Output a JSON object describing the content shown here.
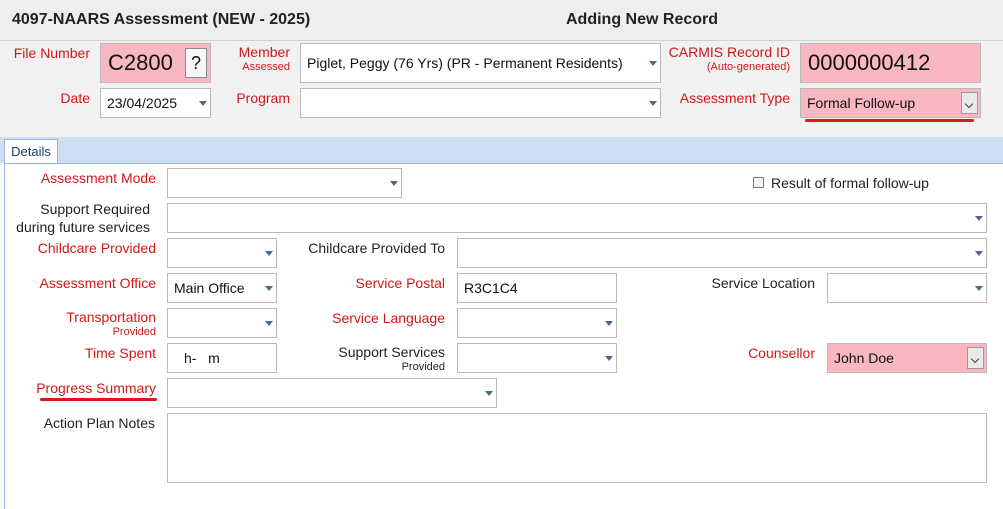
{
  "header": {
    "title": "4097-NAARS Assessment (NEW - 2025)",
    "mode": "Adding New Record"
  },
  "top_form": {
    "file_number": {
      "label": "File Number",
      "value": "C2800",
      "button_label": "?"
    },
    "member": {
      "label": "Member",
      "sublabel": "Assessed",
      "value": "Piglet, Peggy (76 Yrs) (PR - Permanent Residents)"
    },
    "carmis": {
      "label": "CARMIS Record ID",
      "sublabel": "(Auto-generated)",
      "value": "0000000412"
    },
    "date": {
      "label": "Date",
      "value": "23/04/2025"
    },
    "program": {
      "label": "Program",
      "value": ""
    },
    "assessment_type": {
      "label": "Assessment Type",
      "value": "Formal Follow-up"
    }
  },
  "tabs": [
    {
      "label": "Details",
      "active": true
    }
  ],
  "details": {
    "assessment_mode": {
      "label": "Assessment Mode",
      "value": ""
    },
    "formal_followup_checkbox": {
      "label": "Result of formal follow-up",
      "checked": false
    },
    "support_required": {
      "label_line1": "Support Required",
      "label_line2": "during future services",
      "value": ""
    },
    "childcare_provided": {
      "label": "Childcare Provided",
      "value": ""
    },
    "childcare_provided_to": {
      "label": "Childcare Provided To",
      "value": ""
    },
    "assessment_office": {
      "label": "Assessment Office",
      "value": "Main Office"
    },
    "service_postal": {
      "label": "Service Postal",
      "value": "R3C1C4"
    },
    "service_location": {
      "label": "Service Location",
      "value": ""
    },
    "transportation": {
      "label": "Transportation",
      "sublabel": "Provided",
      "value": ""
    },
    "service_language": {
      "label": "Service Language",
      "value": ""
    },
    "time_spent": {
      "label": "Time Spent",
      "value": "h-   m"
    },
    "support_services": {
      "label": "Support Services",
      "sublabel": "Provided",
      "value": ""
    },
    "counsellor": {
      "label": "Counsellor",
      "value": "John Doe"
    },
    "progress_summary": {
      "label": "Progress Summary",
      "value": ""
    },
    "action_plan_notes": {
      "label": "Action Plan Notes",
      "value": ""
    }
  },
  "colors": {
    "required_label": "#d01818",
    "required_field": "#f9b7c1",
    "highlight_underline": "#d81a1a",
    "tab_strip": "#cfdff3"
  }
}
